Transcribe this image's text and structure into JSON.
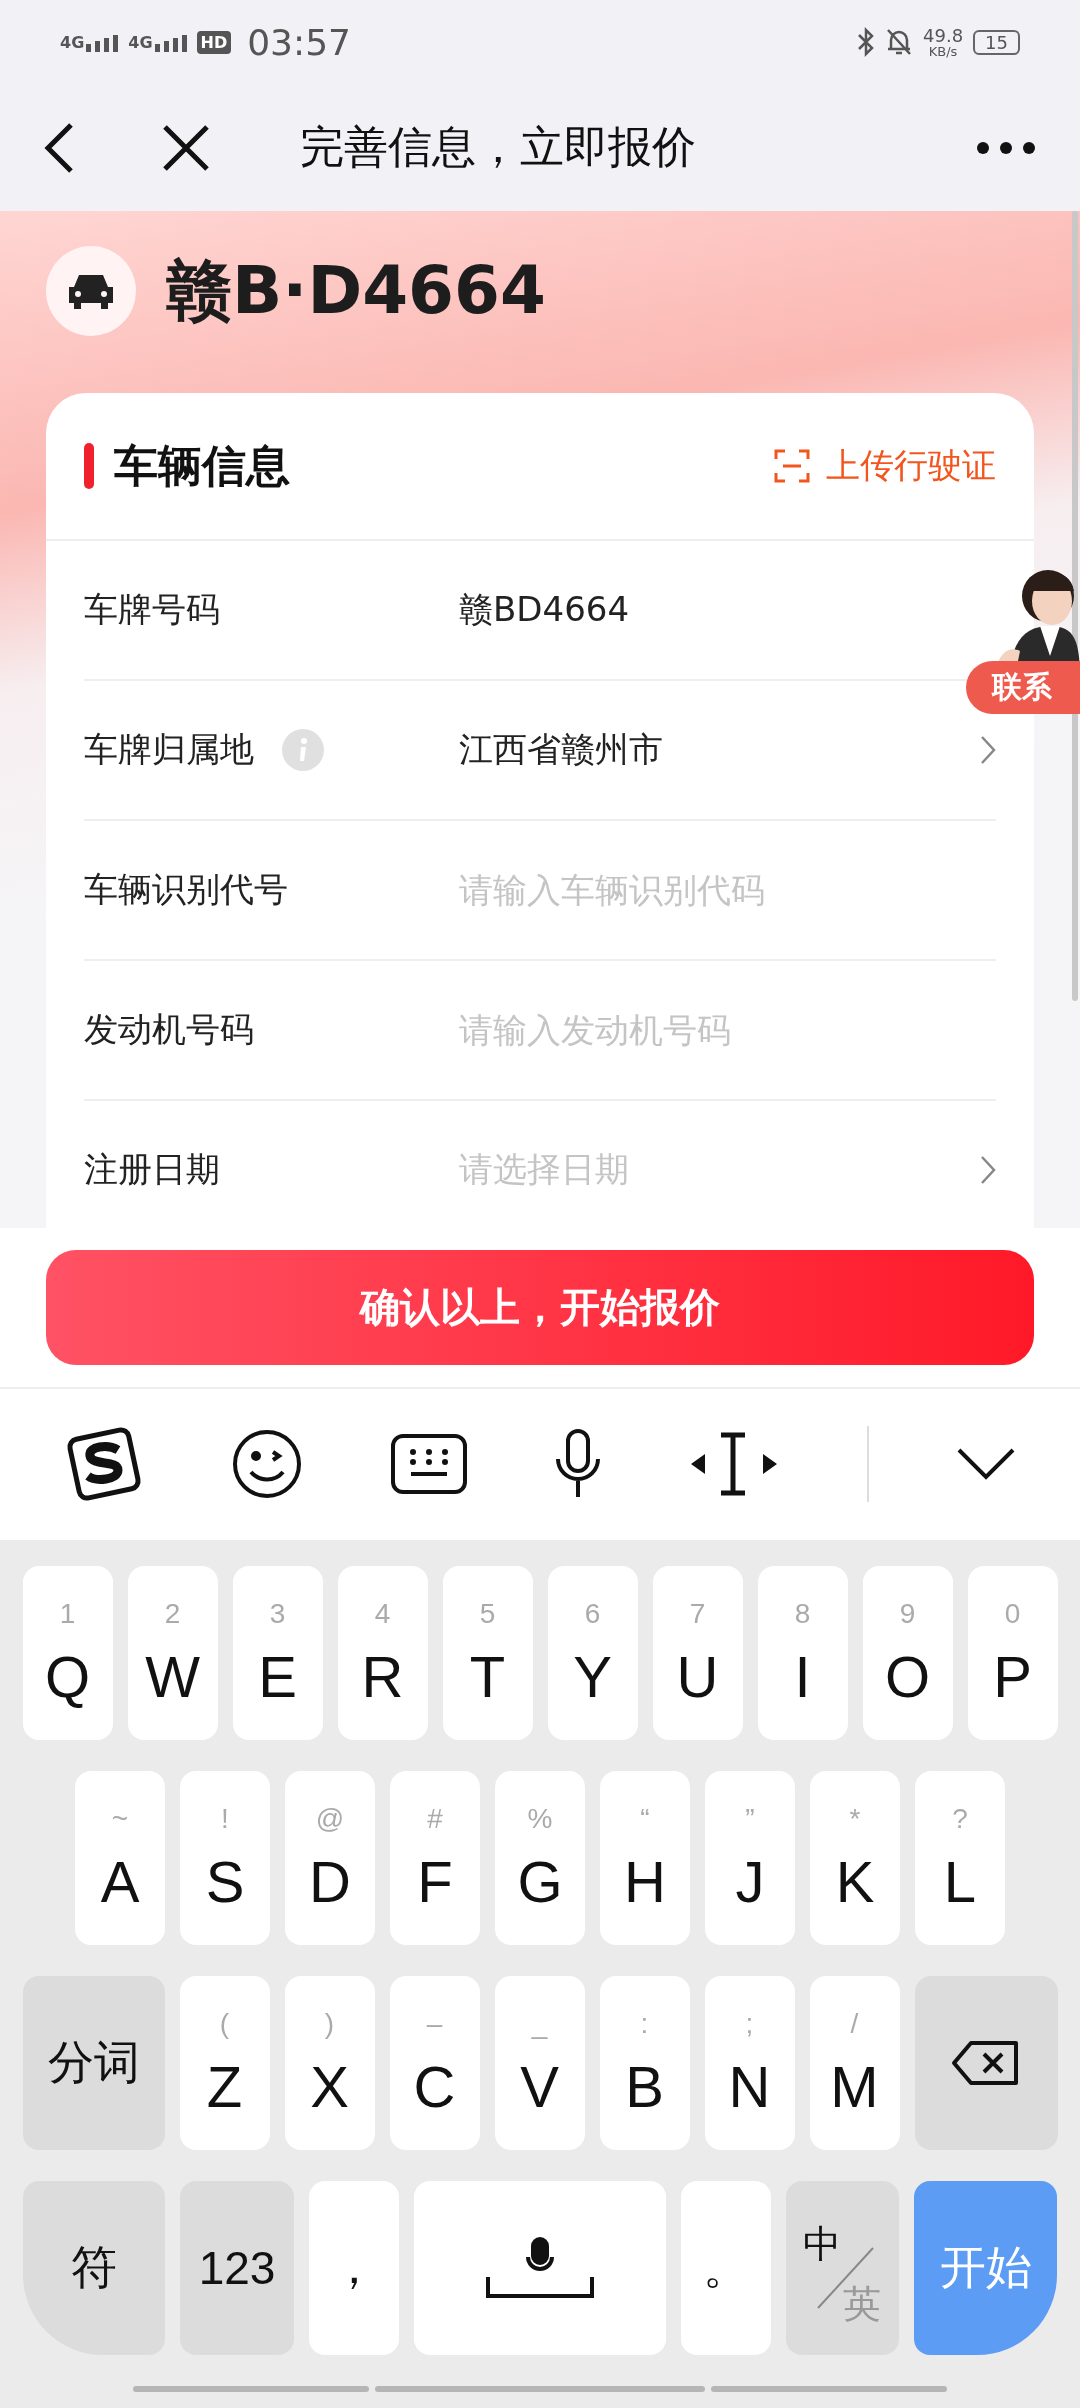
{
  "status_bar": {
    "networks": [
      "4G",
      "4G"
    ],
    "hd": "HD",
    "time": "03:57",
    "speed": "49.8",
    "speed_unit": "KB/s",
    "battery": "15"
  },
  "nav": {
    "title": "完善信息，立即报价"
  },
  "plate": "赣B·D4664",
  "card": {
    "title": "车辆信息",
    "action": "上传行驶证",
    "fields": [
      {
        "label": "车牌号码",
        "kind": "text",
        "value": "赣BD4664"
      },
      {
        "label": "车牌归属地",
        "kind": "select",
        "value": "江西省赣州市",
        "info": true,
        "chevron": true
      },
      {
        "label": "车辆识别代号",
        "kind": "input",
        "placeholder": "请输入车辆识别代码"
      },
      {
        "label": "发动机号码",
        "kind": "input",
        "placeholder": "请输入发动机号码"
      },
      {
        "label": "注册日期",
        "kind": "select",
        "placeholder": "请选择日期",
        "chevron": true
      }
    ]
  },
  "contact": {
    "label": "联系"
  },
  "submit": "确认以上，开始报价",
  "keyboard": {
    "top_row": [
      {
        "kind": "letter",
        "label": "Q",
        "hint": "1"
      },
      {
        "kind": "letter",
        "label": "W",
        "hint": "2"
      },
      {
        "kind": "letter",
        "label": "E",
        "hint": "3"
      },
      {
        "kind": "letter",
        "label": "R",
        "hint": "4"
      },
      {
        "kind": "letter",
        "label": "T",
        "hint": "5"
      },
      {
        "kind": "letter",
        "label": "Y",
        "hint": "6"
      },
      {
        "kind": "letter",
        "label": "U",
        "hint": "7"
      },
      {
        "kind": "letter",
        "label": "I",
        "hint": "8"
      },
      {
        "kind": "letter",
        "label": "O",
        "hint": "9"
      },
      {
        "kind": "letter",
        "label": "P",
        "hint": "0"
      }
    ],
    "home_row": [
      {
        "kind": "letter",
        "label": "A",
        "hint": "~"
      },
      {
        "kind": "letter",
        "label": "S",
        "hint": "!"
      },
      {
        "kind": "letter",
        "label": "D",
        "hint": "@"
      },
      {
        "kind": "letter",
        "label": "F",
        "hint": "#"
      },
      {
        "kind": "letter",
        "label": "G",
        "hint": "%"
      },
      {
        "kind": "letter",
        "label": "H",
        "hint": "“"
      },
      {
        "kind": "letter",
        "label": "J",
        "hint": "”"
      },
      {
        "kind": "letter",
        "label": "K",
        "hint": "*"
      },
      {
        "kind": "letter",
        "label": "L",
        "hint": "?"
      }
    ],
    "bottom_row": [
      {
        "kind": "function",
        "label": "分词"
      },
      {
        "kind": "letter",
        "label": "Z",
        "hint": "("
      },
      {
        "kind": "letter",
        "label": "X",
        "hint": ")"
      },
      {
        "kind": "letter",
        "label": "C",
        "hint": "–"
      },
      {
        "kind": "letter",
        "label": "V",
        "hint": "_"
      },
      {
        "kind": "letter",
        "label": "B",
        "hint": ":"
      },
      {
        "kind": "letter",
        "label": "N",
        "hint": ";"
      },
      {
        "kind": "letter",
        "label": "M",
        "hint": "/"
      },
      {
        "kind": "backspace"
      }
    ],
    "function_row": [
      {
        "kind": "symbols",
        "label": "符"
      },
      {
        "kind": "numbers",
        "label": "123"
      },
      {
        "kind": "punct",
        "label": "，"
      },
      {
        "kind": "space"
      },
      {
        "kind": "punct",
        "label": "。"
      },
      {
        "kind": "lang",
        "primary": "中",
        "secondary": "英"
      },
      {
        "kind": "enter",
        "label": "开始"
      }
    ]
  }
}
